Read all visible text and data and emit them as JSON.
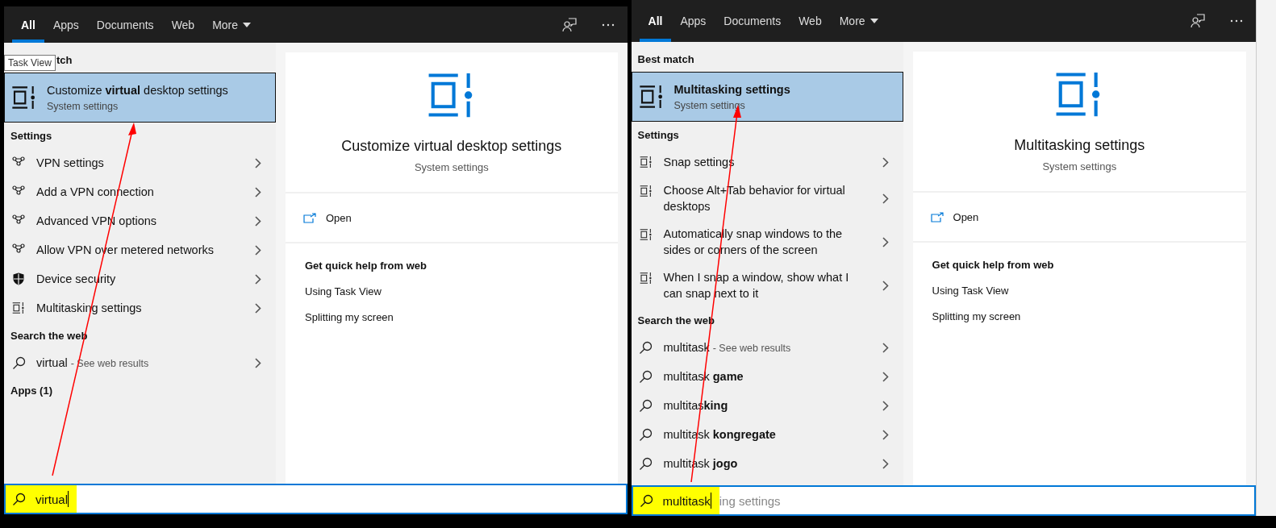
{
  "panels": [
    {
      "tabs": [
        {
          "label": "All",
          "selected": true
        },
        {
          "label": "Apps",
          "selected": false
        },
        {
          "label": "Documents",
          "selected": false
        },
        {
          "label": "Web",
          "selected": false
        },
        {
          "label": "More",
          "selected": false,
          "dropdown": true
        }
      ],
      "tooltip": "Task View",
      "best_match": {
        "header": "tch",
        "title": "Customize **virtual** desktop settings",
        "subtitle": "System settings",
        "selected": true
      },
      "sections": [
        {
          "header": "Settings",
          "items": [
            {
              "kind": "vpn",
              "text": "VPN settings"
            },
            {
              "kind": "vpn",
              "text": "Add a VPN connection"
            },
            {
              "kind": "vpn",
              "text": "Advanced VPN options"
            },
            {
              "kind": "vpn",
              "text": "Allow VPN over metered networks"
            },
            {
              "kind": "security",
              "text": "Device security"
            },
            {
              "kind": "taskview",
              "text": "Multitasking settings"
            }
          ]
        },
        {
          "header": "Search the web",
          "items": [
            {
              "kind": "web",
              "text": "virtual",
              "hint": "- See web results"
            }
          ]
        },
        {
          "header": "Apps (1)"
        }
      ],
      "preview": {
        "title": "Customize virtual desktop settings",
        "subtitle": "System settings",
        "action": "Open",
        "help_header": "Get quick help from web",
        "links": [
          "Using Task View",
          "Splitting my screen"
        ]
      },
      "search": {
        "value": "virtual",
        "highlighted": true
      }
    },
    {
      "tabs": [
        {
          "label": "All",
          "selected": true
        },
        {
          "label": "Apps",
          "selected": false
        },
        {
          "label": "Documents",
          "selected": false
        },
        {
          "label": "Web",
          "selected": false
        },
        {
          "label": "More",
          "selected": false,
          "dropdown": true
        }
      ],
      "best_match": {
        "header": "Best match",
        "title": "**Multitasking settings**",
        "subtitle": "System settings",
        "selected": true
      },
      "sections": [
        {
          "header": "Settings",
          "items": [
            {
              "kind": "taskview",
              "text": "Snap settings"
            },
            {
              "kind": "taskview",
              "text": "Choose Alt+Tab behavior for virtual desktops"
            },
            {
              "kind": "taskview",
              "text": "Automatically snap windows to the sides or corners of the screen"
            },
            {
              "kind": "taskview",
              "text": "When I snap a window, show what I can snap next to it"
            }
          ]
        },
        {
          "header": "Search the web",
          "items": [
            {
              "kind": "web",
              "text": "multitask",
              "hint": "- See web results"
            },
            {
              "kind": "web",
              "text": "multitask **game**"
            },
            {
              "kind": "web",
              "text": "multitas**king**"
            },
            {
              "kind": "web",
              "text": "multitask **kongregate**"
            },
            {
              "kind": "web",
              "text": "multitask **jogo**"
            }
          ]
        }
      ],
      "preview": {
        "title": "Multitasking settings",
        "subtitle": "System settings",
        "action": "Open",
        "help_header": "Get quick help from web",
        "links": [
          "Using Task View",
          "Splitting my screen"
        ]
      },
      "search": {
        "value": "multitask",
        "suggestion": "ing settings",
        "highlighted": true
      }
    }
  ]
}
